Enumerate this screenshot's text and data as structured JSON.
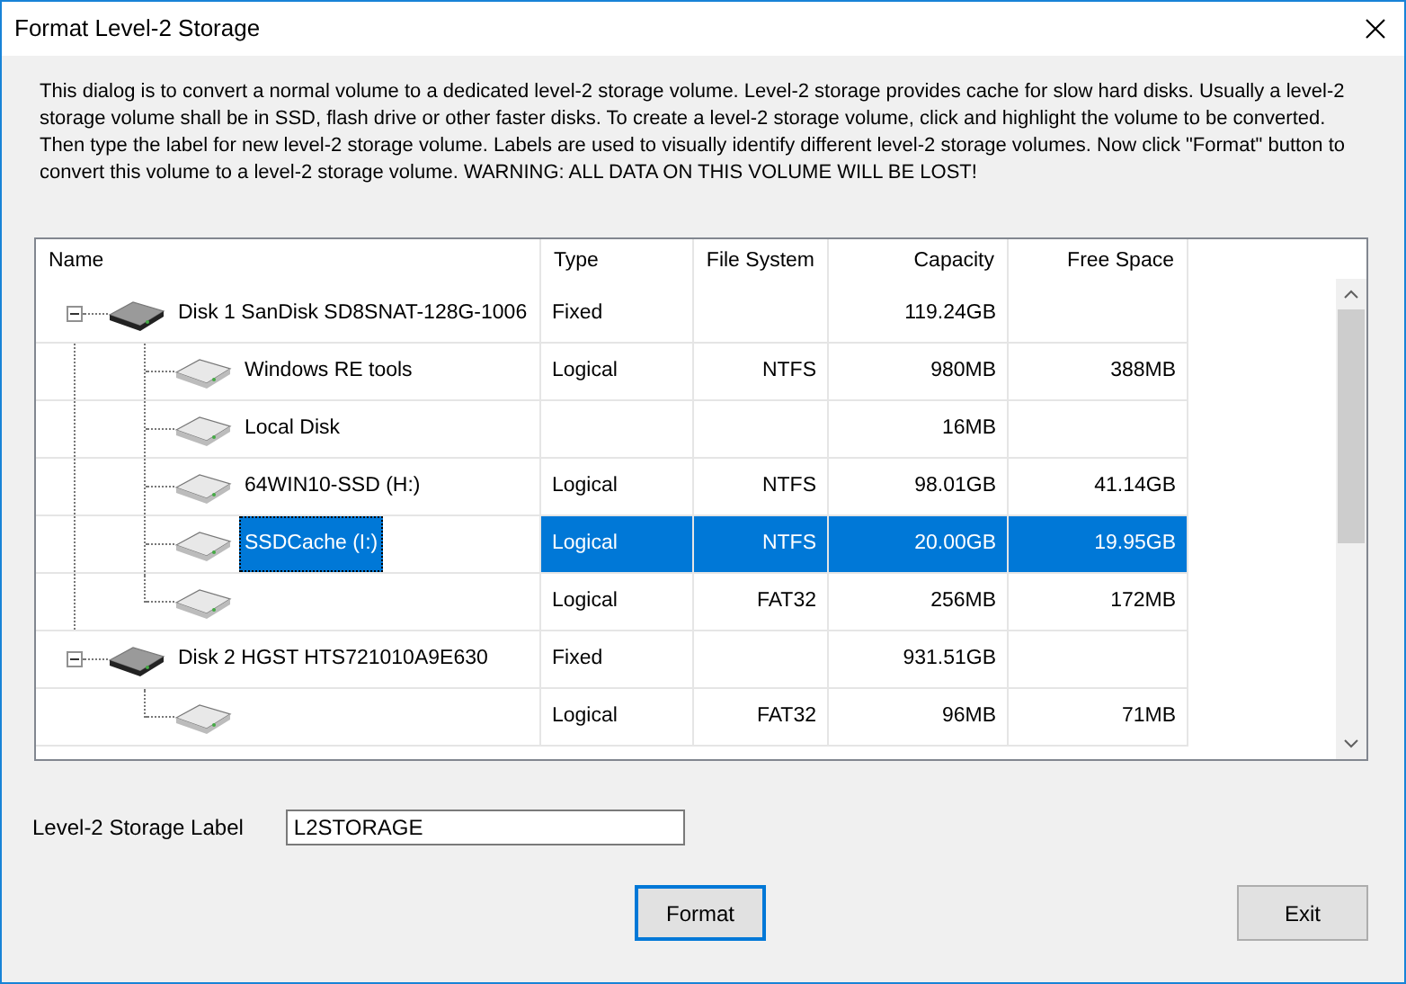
{
  "window": {
    "title": "Format Level-2 Storage"
  },
  "description": "This dialog is to convert a normal volume to a dedicated level-2 storage volume. Level-2 storage provides cache for slow hard disks. Usually a level-2 storage volume shall be in SSD, flash drive or other faster disks. To create a level-2 storage volume, click and highlight the volume to be converted. Then type the label for new level-2 storage volume. Labels are used to visually identify different level-2 storage volumes. Now click \"Format\" button to convert this volume to a level-2 storage volume. WARNING: ALL DATA ON THIS VOLUME WILL BE LOST!",
  "table": {
    "columns": [
      "Name",
      "Type",
      "File System",
      "Capacity",
      "Free Space"
    ],
    "rows": [
      {
        "name": "Disk 1 SanDisk SD8SNAT-128G-1006",
        "type": "Fixed",
        "capacity": "119.24GB",
        "selected": false,
        "expanded": true,
        "children": [
          {
            "name": "Windows RE tools",
            "type": "Logical",
            "file_system": "NTFS",
            "capacity": "980MB",
            "free_space": "388MB",
            "selected": false
          },
          {
            "name": "Local Disk",
            "capacity": "16MB",
            "selected": false
          },
          {
            "name": "64WIN10-SSD (H:)",
            "type": "Logical",
            "file_system": "NTFS",
            "capacity": "98.01GB",
            "free_space": "41.14GB",
            "selected": false
          },
          {
            "name": "SSDCache (I:)",
            "type": "Logical",
            "file_system": "NTFS",
            "capacity": "20.00GB",
            "free_space": "19.95GB",
            "selected": true
          },
          {
            "type": "Logical",
            "file_system": "FAT32",
            "capacity": "256MB",
            "free_space": "172MB",
            "selected": false
          }
        ]
      },
      {
        "name": "Disk 2 HGST HTS721010A9E630",
        "type": "Fixed",
        "capacity": "931.51GB",
        "selected": false,
        "expanded": true,
        "children": [
          {
            "type": "Logical",
            "file_system": "FAT32",
            "capacity": "96MB",
            "free_space": "71MB",
            "selected": false
          }
        ]
      }
    ]
  },
  "label_field": {
    "label": "Level-2 Storage Label",
    "value": "L2STORAGE"
  },
  "buttons": [
    {
      "label": "Format",
      "default": true
    },
    {
      "label": "Exit",
      "default": false
    }
  ]
}
